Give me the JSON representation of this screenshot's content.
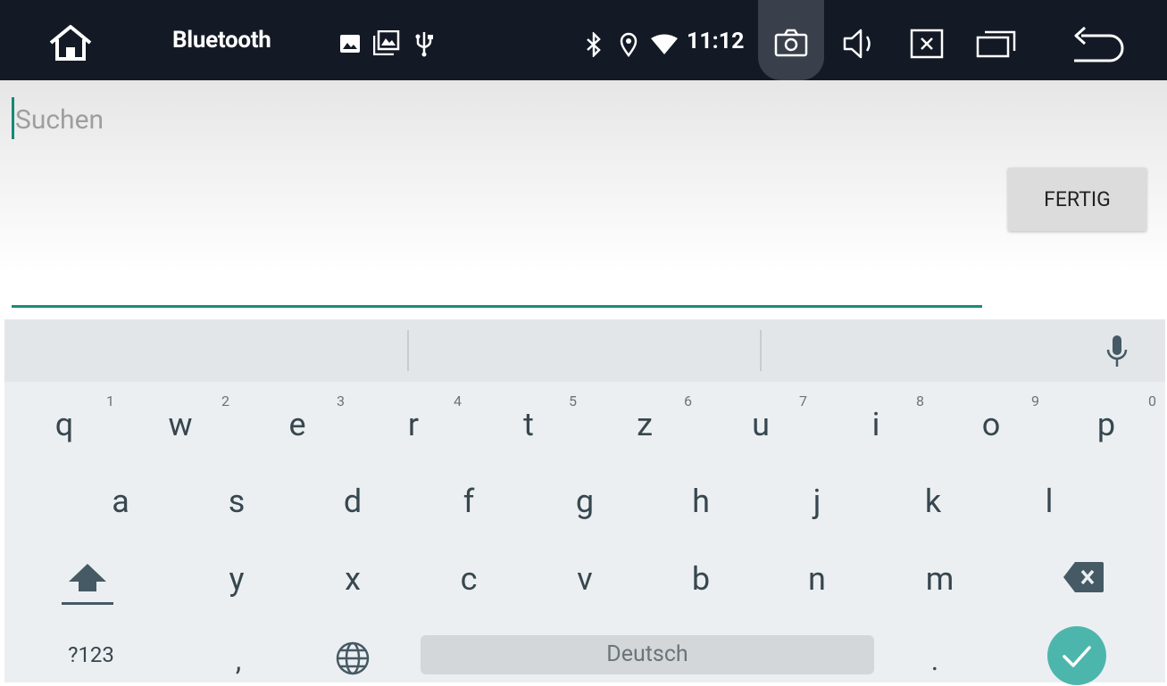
{
  "status_bar": {
    "title": "Bluetooth",
    "time": "11:12",
    "icons": [
      "home-icon",
      "image-icon",
      "gallery-icon",
      "usb-icon",
      "bluetooth-icon",
      "location-icon",
      "wifi-icon",
      "camera-icon",
      "volume-icon",
      "close-box-icon",
      "windows-icon",
      "back-icon"
    ]
  },
  "search": {
    "placeholder": "Suchen",
    "value": "",
    "done_label": "FERTIG"
  },
  "keyboard": {
    "row1": [
      {
        "key": "q",
        "num": "1"
      },
      {
        "key": "w",
        "num": "2"
      },
      {
        "key": "e",
        "num": "3"
      },
      {
        "key": "r",
        "num": "4"
      },
      {
        "key": "t",
        "num": "5"
      },
      {
        "key": "z",
        "num": "6"
      },
      {
        "key": "u",
        "num": "7"
      },
      {
        "key": "i",
        "num": "8"
      },
      {
        "key": "o",
        "num": "9"
      },
      {
        "key": "p",
        "num": "0"
      }
    ],
    "row2": [
      "a",
      "s",
      "d",
      "f",
      "g",
      "h",
      "j",
      "k",
      "l"
    ],
    "row3": [
      "y",
      "x",
      "c",
      "v",
      "b",
      "n",
      "m"
    ],
    "symbols_label": "?123",
    "comma": ",",
    "period": ".",
    "space_label": "Deutsch",
    "accent_color": "#4db6ac"
  }
}
